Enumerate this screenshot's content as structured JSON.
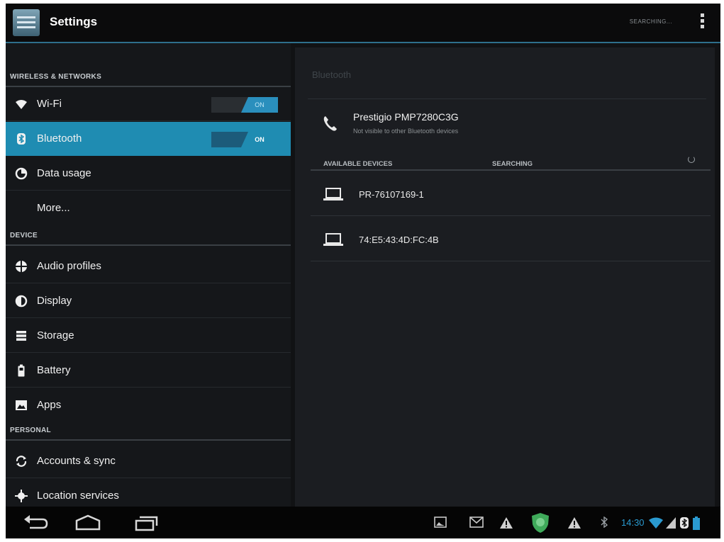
{
  "action_bar": {
    "title": "Settings",
    "searching_action": "SEARCHING..."
  },
  "sidebar": {
    "headers": {
      "wireless": "WIRELESS & NETWORKS",
      "device": "DEVICE",
      "personal": "PERSONAL"
    },
    "items": [
      {
        "label": "Wi-Fi",
        "toggle": "ON"
      },
      {
        "label": "Bluetooth",
        "toggle": "ON"
      },
      {
        "label": "Data usage"
      },
      {
        "label": "More..."
      },
      {
        "label": "Audio profiles"
      },
      {
        "label": "Display"
      },
      {
        "label": "Storage"
      },
      {
        "label": "Battery"
      },
      {
        "label": "Apps"
      },
      {
        "label": "Accounts & sync"
      },
      {
        "label": "Location services"
      }
    ]
  },
  "bluetooth": {
    "title": "Bluetooth",
    "device_name": "Prestigio PMP7280C3G",
    "device_visibility": "Not visible to other Bluetooth devices",
    "available_header": "AVAILABLE DEVICES",
    "searching_status": "SEARCHING",
    "devices": [
      "PR-76107169-1",
      "74:E5:43:4D:FC:4B"
    ]
  },
  "status_bar": {
    "time": "14:30"
  },
  "colors": {
    "accent": "#1f8cb2",
    "background": "#15171a",
    "time": "#2a9ad0"
  }
}
